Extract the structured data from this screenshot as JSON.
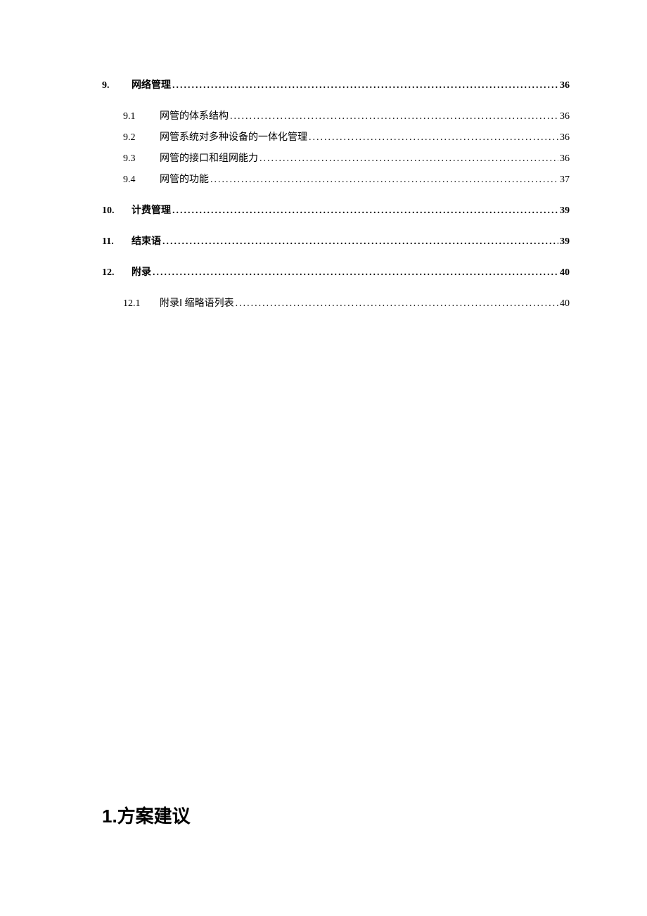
{
  "toc": {
    "entries": [
      {
        "type": "main",
        "num": "9.",
        "title": "网络管理",
        "page": "36"
      },
      {
        "type": "sub",
        "num": "9.1",
        "title": "网管的体系结构",
        "page": "36"
      },
      {
        "type": "sub",
        "num": "9.2",
        "title": "网管系统对多种设备的一体化管理",
        "page": "36"
      },
      {
        "type": "sub",
        "num": "9.3",
        "title": "网管的接口和组网能力",
        "page": "36"
      },
      {
        "type": "sub",
        "num": "9.4",
        "title": "网管的功能",
        "page": "37"
      },
      {
        "type": "main",
        "num": "10.",
        "title": "计费管理",
        "page": "39"
      },
      {
        "type": "main",
        "num": "11.",
        "title": "结束语",
        "page": "39"
      },
      {
        "type": "main",
        "num": "12.",
        "title": "附录",
        "page": "40"
      },
      {
        "type": "sub",
        "num": "12.1",
        "title": "附录Ⅰ 缩略语列表",
        "page": "40"
      }
    ]
  },
  "heading": {
    "text": "1.方案建议"
  }
}
